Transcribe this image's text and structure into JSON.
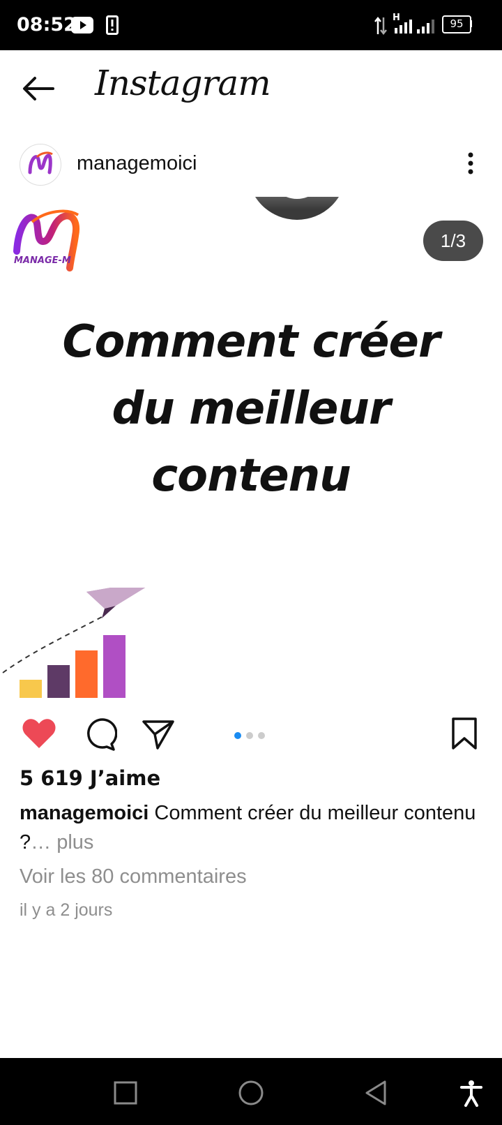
{
  "status_bar": {
    "time": "08:52",
    "battery": "95",
    "network": "H"
  },
  "app": {
    "title": "Instagram"
  },
  "post": {
    "username": "managemoici",
    "slide_counter": "1/3",
    "image": {
      "brand": "MANAGE-M",
      "headline": [
        "Comment créer",
        "du meilleur",
        "contenu"
      ]
    },
    "carousel": {
      "total": 3,
      "active": 1
    },
    "likes": "5 619 J’aime",
    "caption_user": "managemoici",
    "caption_text": "Comment créer du meilleur contenu ?",
    "caption_more": "… plus",
    "comments_link": "Voir les 80 commentaires",
    "timestamp": "il y a 2 jours"
  },
  "colors": {
    "like_red": "#ed4956",
    "dot_active": "#1a8cf2",
    "bar_yellow": "#f8c84c",
    "bar_purple_dark": "#5e3a66",
    "bar_orange": "#ff6a2c",
    "bar_purple": "#b04fc4",
    "plane": "#b595b6"
  },
  "icons": {
    "back": "arrow-left-icon",
    "more": "more-vertical-icon",
    "like": "heart-filled-icon",
    "comment": "comment-bubble-icon",
    "share": "paper-plane-icon",
    "save": "bookmark-icon"
  }
}
